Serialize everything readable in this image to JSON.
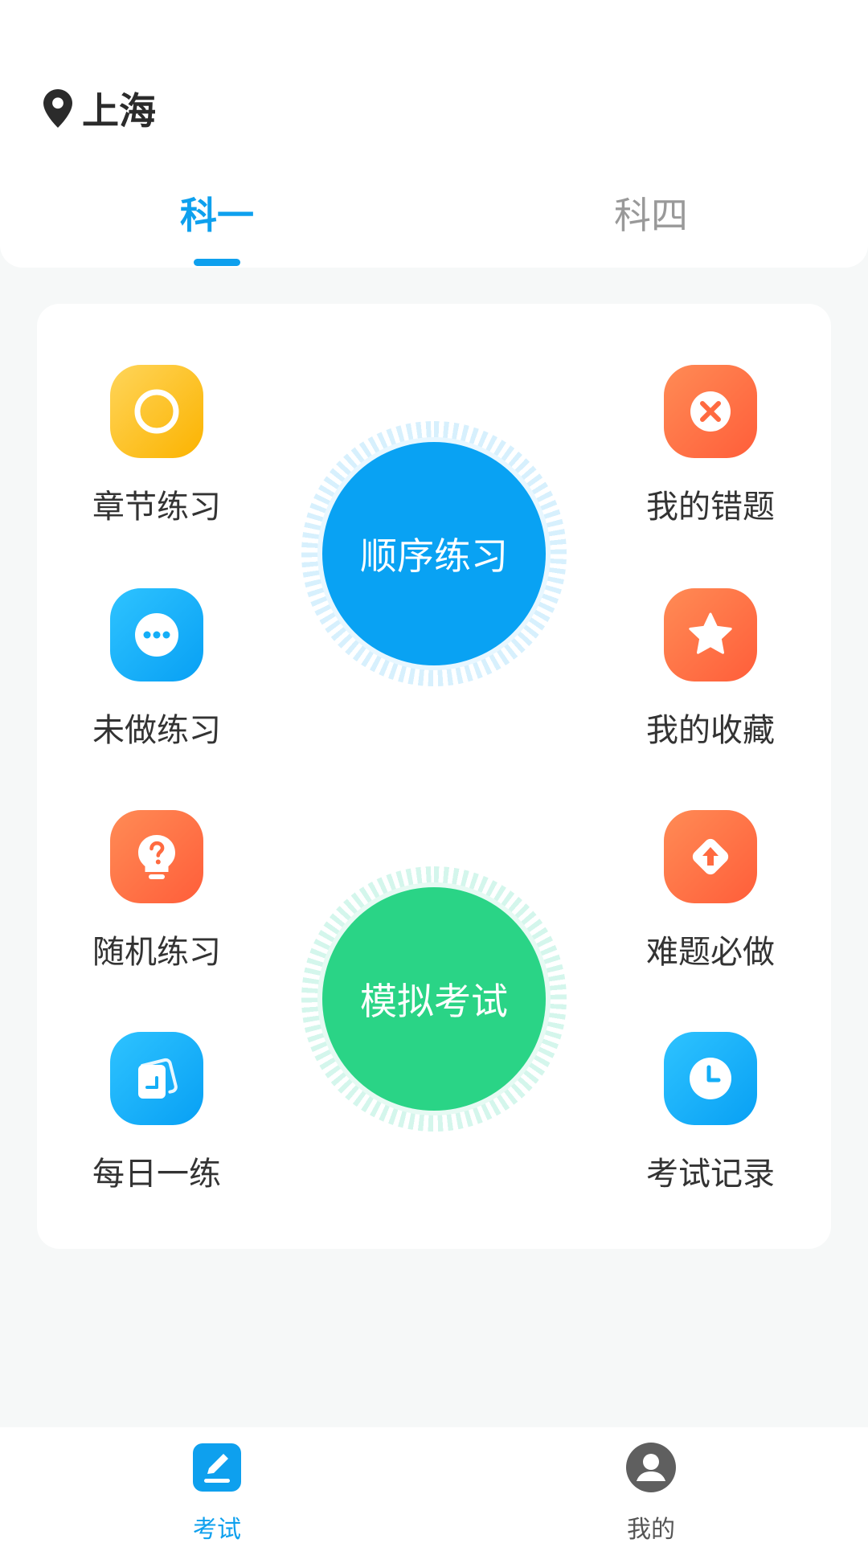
{
  "location": {
    "city": "上海",
    "icon": "location-pin-icon"
  },
  "tabs": [
    {
      "label": "科一",
      "active": true
    },
    {
      "label": "科四",
      "active": false
    }
  ],
  "practice": {
    "left": [
      {
        "label": "章节练习",
        "icon": "ring-target-icon",
        "color": "#fbb300"
      },
      {
        "label": "未做练习",
        "icon": "ellipsis-chat-icon",
        "color": "#08a0f4"
      },
      {
        "label": "随机练习",
        "icon": "question-bulb-icon",
        "color": "#ff5e3a"
      },
      {
        "label": "每日一练",
        "icon": "notebook-icon",
        "color": "#08a0f4"
      }
    ],
    "right": [
      {
        "label": "我的错题",
        "icon": "close-circle-icon",
        "color": "#ff5e3a"
      },
      {
        "label": "我的收藏",
        "icon": "star-icon",
        "color": "#ff5e3a"
      },
      {
        "label": "难题必做",
        "icon": "arrow-up-diamond-icon",
        "color": "#ff5e3a"
      },
      {
        "label": "考试记录",
        "icon": "clock-icon",
        "color": "#08a0f4"
      }
    ],
    "sequential": {
      "label": "顺序练习",
      "color": "#09a2f3"
    },
    "mock_exam": {
      "label": "模拟考试",
      "color": "#2ad486"
    }
  },
  "bottom_nav": [
    {
      "label": "考试",
      "icon": "exam-edit-icon",
      "active": true
    },
    {
      "label": "我的",
      "icon": "user-avatar-icon",
      "active": false
    }
  ],
  "colors": {
    "accent": "#0ea0ee",
    "background": "#f6f8f8"
  }
}
